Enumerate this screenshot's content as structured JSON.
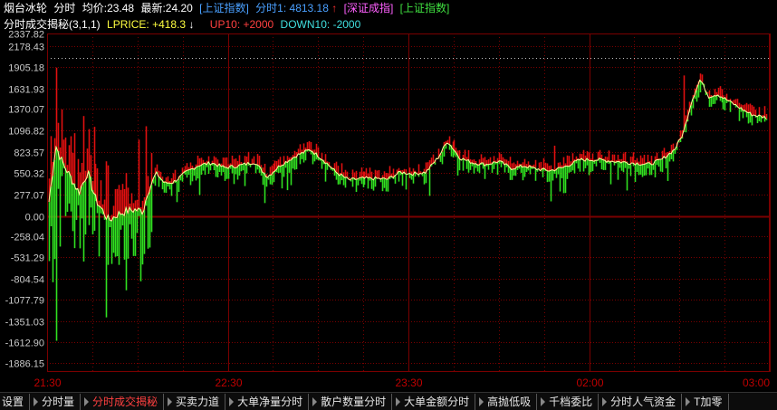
{
  "header": {
    "stock_name": "烟台冰轮",
    "mode": "分时",
    "avg_label": "均价:",
    "avg_value": "23.48",
    "latest_label": "最新:",
    "latest_value": "24.20",
    "index_tag1": "[上证指数]",
    "fenshi_label": "分时1:",
    "fenshi_value": "4813.18",
    "fenshi_arrow": "↑",
    "index_tag2": "[深证成指]",
    "index_tag3": "[上证指数]"
  },
  "indicator": {
    "name": "分时成交揭秘(3,1,1)",
    "lprice_label": "LPRICE:",
    "lprice_value": "+418.3",
    "lprice_arrow": "↓",
    "up_label": "UP10:",
    "up_value": "+2000",
    "down_label": "DOWN10:",
    "down_value": "-2000"
  },
  "colors": {
    "background": "#000000",
    "grid": "#7a0000",
    "axis_text": "#c8c8c8",
    "time_text": "#c00000",
    "up_bar": "#e01010",
    "down_bar": "#30e020",
    "line": "#ffffa0",
    "header_white": "#ffffff",
    "header_blue": "#4aa0ff",
    "header_magenta": "#ff60ff",
    "header_green": "#40e040",
    "header_yellow": "#ffff40",
    "header_cyan": "#40e0e0",
    "header_red": "#ff4040"
  },
  "chart_data": {
    "type": "bar",
    "ylim": [
      -2000,
      2337.82
    ],
    "y_ticks": [
      "2337.82",
      "2178.43",
      "1905.18",
      "1631.93",
      "1370.07",
      "1096.82",
      "823.57",
      "550.32",
      "277.07",
      "0.00",
      "-258.04",
      "-531.29",
      "-804.54",
      "-1077.79",
      "-1351.03",
      "-1612.90",
      "-1886.15"
    ],
    "x_ticks": [
      "21:30",
      "22:30",
      "23:30",
      "02:00",
      "03:00"
    ],
    "line_anchors": [
      [
        0,
        180
      ],
      [
        8,
        900
      ],
      [
        15,
        700
      ],
      [
        25,
        500
      ],
      [
        35,
        300
      ],
      [
        45,
        560
      ],
      [
        55,
        200
      ],
      [
        70,
        -60
      ],
      [
        80,
        20
      ],
      [
        90,
        60
      ],
      [
        100,
        80
      ],
      [
        110,
        60
      ],
      [
        115,
        300
      ],
      [
        125,
        550
      ],
      [
        135,
        420
      ],
      [
        145,
        430
      ],
      [
        160,
        560
      ],
      [
        175,
        650
      ],
      [
        190,
        680
      ],
      [
        205,
        620
      ],
      [
        220,
        640
      ],
      [
        240,
        690
      ],
      [
        255,
        500
      ],
      [
        270,
        650
      ],
      [
        290,
        780
      ],
      [
        305,
        850
      ],
      [
        320,
        720
      ],
      [
        335,
        560
      ],
      [
        350,
        460
      ],
      [
        365,
        480
      ],
      [
        380,
        480
      ],
      [
        395,
        470
      ],
      [
        410,
        560
      ],
      [
        425,
        540
      ],
      [
        440,
        560
      ],
      [
        455,
        760
      ],
      [
        465,
        960
      ],
      [
        480,
        740
      ],
      [
        495,
        680
      ],
      [
        510,
        660
      ],
      [
        525,
        700
      ],
      [
        540,
        610
      ],
      [
        555,
        640
      ],
      [
        570,
        600
      ],
      [
        585,
        580
      ],
      [
        600,
        620
      ],
      [
        620,
        720
      ],
      [
        640,
        720
      ],
      [
        660,
        700
      ],
      [
        680,
        680
      ],
      [
        700,
        660
      ],
      [
        715,
        720
      ],
      [
        730,
        850
      ],
      [
        740,
        1050
      ],
      [
        750,
        1470
      ],
      [
        760,
        1750
      ],
      [
        770,
        1530
      ],
      [
        780,
        1560
      ],
      [
        795,
        1460
      ],
      [
        810,
        1360
      ],
      [
        820,
        1300
      ],
      [
        837,
        1260
      ]
    ],
    "spikes": [
      [
        4,
        500,
        -850
      ],
      [
        8,
        1900,
        -1600
      ],
      [
        16,
        1600,
        -200
      ],
      [
        45,
        1300,
        -700
      ],
      [
        49,
        1200,
        0
      ],
      [
        67,
        700,
        -1300
      ],
      [
        90,
        550,
        -700
      ],
      [
        91,
        100,
        -1150
      ],
      [
        102,
        0,
        -480
      ],
      [
        108,
        0,
        -550
      ],
      [
        125,
        600,
        0
      ],
      [
        193,
        600,
        0
      ],
      [
        221,
        700,
        0
      ],
      [
        310,
        850,
        0
      ],
      [
        334,
        980,
        0
      ],
      [
        368,
        480,
        0
      ],
      [
        480,
        1150,
        0
      ],
      [
        520,
        1300,
        0
      ],
      [
        590,
        900,
        0
      ],
      [
        606,
        1000,
        0
      ],
      [
        736,
        1600,
        0
      ],
      [
        741,
        1800,
        0
      ],
      [
        754,
        1610,
        0
      ],
      [
        815,
        1560,
        0
      ],
      [
        820,
        1420,
        0
      ]
    ]
  },
  "tabs": [
    {
      "label": "设置",
      "active": false
    },
    {
      "label": "分时量",
      "active": false
    },
    {
      "label": "分时成交揭秘",
      "active": true
    },
    {
      "label": "买卖力道",
      "active": false
    },
    {
      "label": "大单净量分时",
      "active": false
    },
    {
      "label": "散户数量分时",
      "active": false
    },
    {
      "label": "大单金额分时",
      "active": false
    },
    {
      "label": "高抛低吸",
      "active": false
    },
    {
      "label": "千档委比",
      "active": false
    },
    {
      "label": "分时人气资金",
      "active": false
    },
    {
      "label": "T加零",
      "active": false
    }
  ]
}
